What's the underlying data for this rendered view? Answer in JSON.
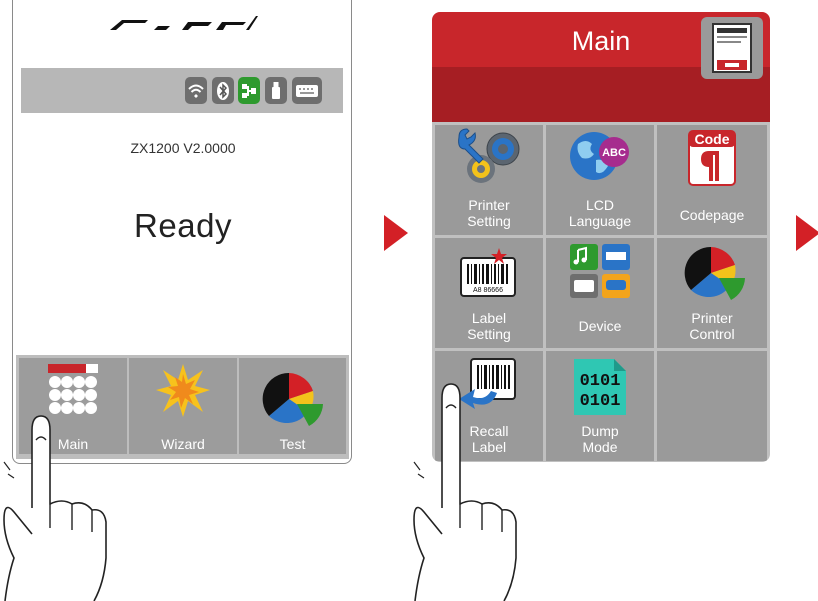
{
  "screen1": {
    "model_version": "ZX1200 V2.0000",
    "status": "Ready",
    "status_icons": [
      "wifi-icon",
      "bluetooth-icon",
      "ethernet-icon",
      "usb-drive-icon",
      "keyboard-icon"
    ],
    "tiles": [
      {
        "label": "Main",
        "icon": "main-menu-icon"
      },
      {
        "label": "Wizard",
        "icon": "wizard-icon"
      },
      {
        "label": "Test",
        "icon": "test-pie-icon"
      }
    ]
  },
  "screen2": {
    "title": "Main",
    "tiles": [
      {
        "label": "Printer\nSetting",
        "icon": "gears-icon"
      },
      {
        "label": "LCD\nLanguage",
        "icon": "globe-abc-icon"
      },
      {
        "label": "Codepage",
        "icon": "code-paragraph-icon",
        "icon_text": "Code"
      },
      {
        "label": "Label\nSetting",
        "icon": "barcode-label-icon",
        "icon_text": "A8 86666"
      },
      {
        "label": "Device",
        "icon": "device-icon"
      },
      {
        "label": "Printer\nControl",
        "icon": "pie-chart-icon"
      },
      {
        "label": "Recall\nLabel",
        "icon": "recall-label-icon"
      },
      {
        "label": "Dump\nMode",
        "icon": "binary-dump-icon",
        "icon_text": "0101\n0101"
      }
    ]
  },
  "colors": {
    "accent_red": "#c8262b",
    "tile_gray": "#9a9a9a",
    "status_bar_gray": "#b7b7b7"
  }
}
